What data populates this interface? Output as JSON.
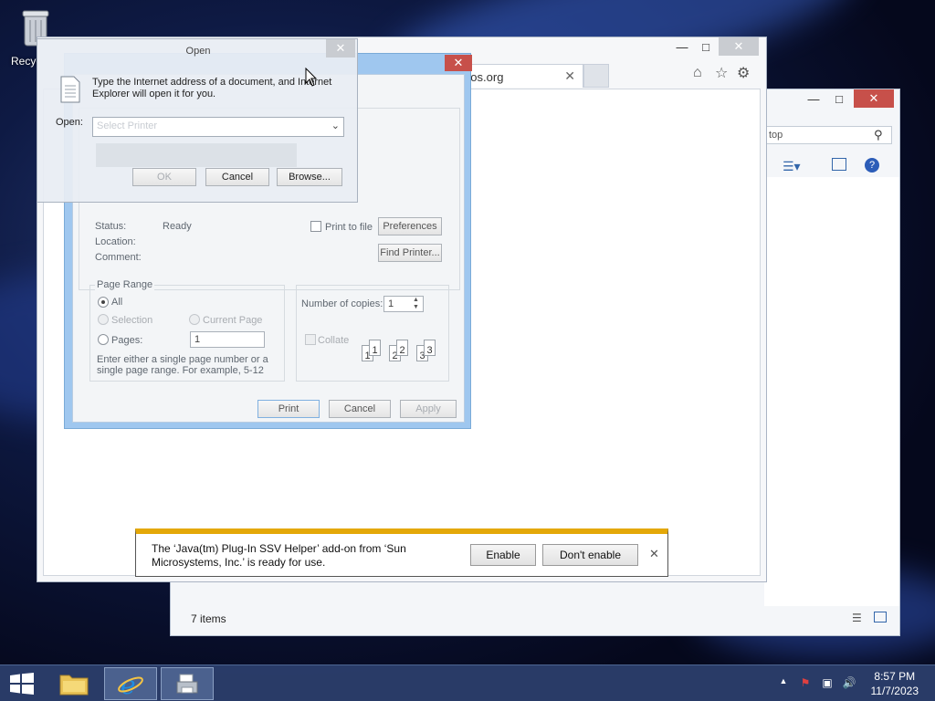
{
  "desktop": {
    "recycle_bin_label": "Recyc"
  },
  "explorer": {
    "search_placeholder": "top",
    "status": "7 items"
  },
  "ie": {
    "tab_title": "remasteros.org"
  },
  "print_dialog": {
    "status_label": "Status:",
    "status_value": "Ready",
    "location_label": "Location:",
    "comment_label": "Comment:",
    "print_to_file_label": "Print to file",
    "preferences_label": "Preferences",
    "find_printer_label": "Find Printer...",
    "page_range_title": "Page Range",
    "all_label": "All",
    "selection_label": "Selection",
    "current_page_label": "Current Page",
    "pages_label": "Pages:",
    "pages_value": "1",
    "pages_hint": "Enter either a single page number or a single page range.  For example, 5-12",
    "copies_label": "Number of copies:",
    "copies_value": "1",
    "collate_label": "Collate",
    "collate_pages": [
      "1",
      "1",
      "2",
      "2",
      "3",
      "3"
    ],
    "print_button": "Print",
    "cancel_button": "Cancel",
    "apply_button": "Apply"
  },
  "run_dialog": {
    "title": "Open",
    "message": "Type the Internet address of a document, and Internet Explorer will open it for you.",
    "open_label": "Open:",
    "open_value": "Select Printer",
    "ok_button": "OK",
    "cancel_button": "Cancel",
    "browse_button": "Browse..."
  },
  "infobar": {
    "message": "The ‘Java(tm) Plug-In SSV Helper’ add-on from ‘Sun Microsystems, Inc.’ is ready for use.",
    "enable_button": "Enable",
    "dont_enable_button": "Don't enable"
  },
  "taskbar": {
    "time": "8:57 PM",
    "date": "11/7/2023"
  },
  "colors": {
    "infobar_accent": "#e4a808",
    "close_red": "#c7504a",
    "taskbar": "#2c406e"
  }
}
